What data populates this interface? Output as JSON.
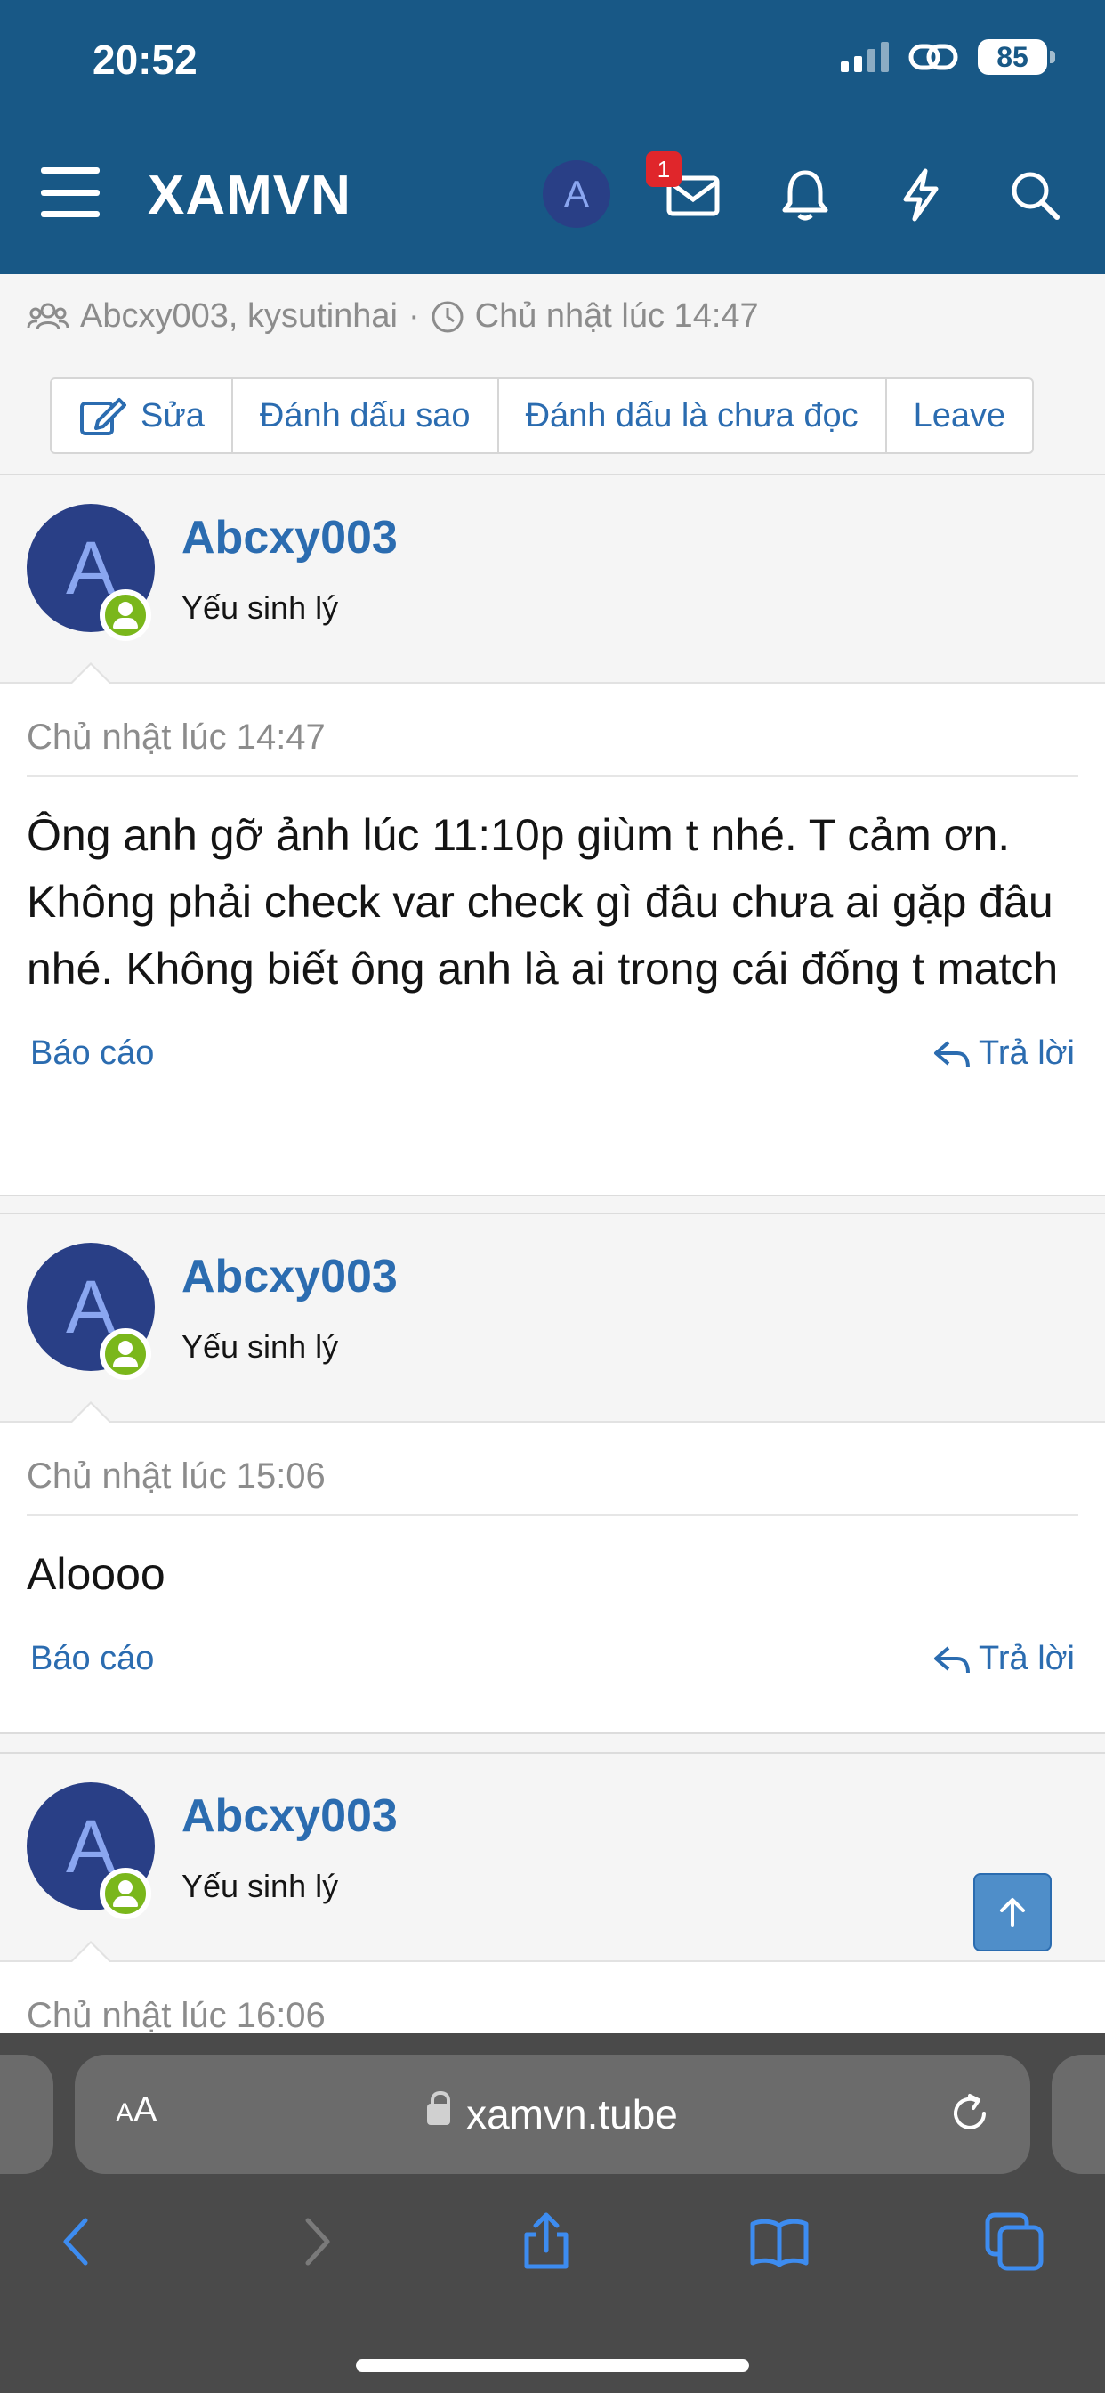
{
  "status": {
    "time": "20:52",
    "battery": "85"
  },
  "nav": {
    "logo": "XAMVN",
    "avatar_letter": "A",
    "inbox_badge": "1"
  },
  "thread": {
    "participants": "Abcxy003, kysutinhai",
    "separator": "·",
    "date": "Chủ nhật lúc 14:47",
    "buttons": {
      "edit": "Sửa",
      "star": "Đánh dấu sao",
      "mark_unread": "Đánh dấu là chưa đọc",
      "leave": "Leave"
    }
  },
  "posts": [
    {
      "avatar_letter": "A",
      "username": "Abcxy003",
      "user_title": "Yếu sinh lý",
      "date": "Chủ nhật lúc 14:47",
      "body": "Ông anh gỡ ảnh lúc 11:10p giùm t nhé. T cảm ơn. Không phải check var check gì đâu chưa ai gặp đâu nhé. Không biết ông anh là ai trong cái đống t match",
      "report": "Báo cáo",
      "reply": "Trả lời"
    },
    {
      "avatar_letter": "A",
      "username": "Abcxy003",
      "user_title": "Yếu sinh lý",
      "date": "Chủ nhật lúc 15:06",
      "body": "Aloooo",
      "report": "Báo cáo",
      "reply": "Trả lời"
    },
    {
      "avatar_letter": "A",
      "username": "Abcxy003",
      "user_title": "Yếu sinh lý",
      "date": "Chủ nhật lúc 16:06"
    }
  ],
  "browser": {
    "aa_big": "A",
    "aa_small": "A",
    "url": "xamvn.tube"
  },
  "icons": {
    "menu": "hamburger-icon",
    "inbox": "envelope-icon",
    "alerts": "bell-icon",
    "whats_new": "lightning-icon",
    "search": "search-icon",
    "edit": "pencil-icon",
    "reply": "reply-arrow-icon",
    "scroll": "arrow-up-icon"
  },
  "colors": {
    "header": "#185886",
    "link": "#2b6cb0",
    "avatar": "#293f86",
    "online": "#7ab71b",
    "badge": "#e0262b"
  }
}
